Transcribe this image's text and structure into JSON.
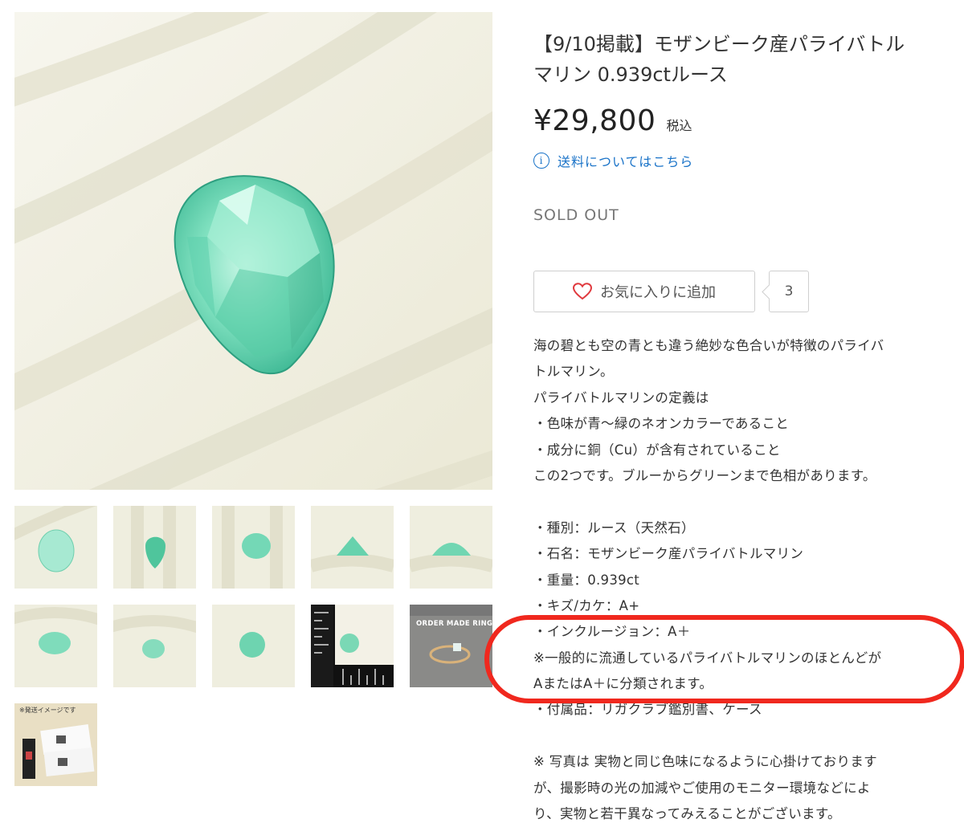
{
  "product": {
    "title": "【9/10掲載】モザンビーク産パライバトルマリン 0.939ctルース",
    "price": "¥29,800",
    "tax_label": "税込",
    "shipping_link": "送料についてはこちら",
    "status": "SOLD OUT",
    "favorite_label": "お気に入りに追加",
    "favorite_count": "3"
  },
  "gallery": {
    "thumbnail_captions": [
      "ORDER MADE RING",
      "※発送イメージです"
    ]
  },
  "description": [
    "海の碧とも空の青とも違う絶妙な色合いが特徴のパライバ",
    "トルマリン。",
    "パライバトルマリンの定義は",
    "・色味が青～緑のネオンカラーであること",
    "・成分に銅（Cu）が含有されていること",
    "この2つです。ブルーからグリーンまで色相があります。",
    "",
    "・種別：ルース（天然石）",
    "・石名：モザンビーク産パライバトルマリン",
    "・重量：0.939ct",
    "・キズ/カケ：A+",
    "・インクルージョン：A＋",
    "※一般的に流通しているパライバトルマリンのほとんどが",
    "AまたはA＋に分類されます。",
    "・付属品：リガクラブ鑑別書、ケース",
    "",
    "※ 写真は 実物と同じ色味になるように心掛けております",
    "が、撮影時の光の加減やご使用のモニター環境などによ",
    "り、実物と若干異なってみえることがございます。"
  ],
  "colors": {
    "link": "#1a73c8",
    "gem": "#6fdcb6",
    "highlight": "#f0281e",
    "heart": "#e0393e"
  }
}
